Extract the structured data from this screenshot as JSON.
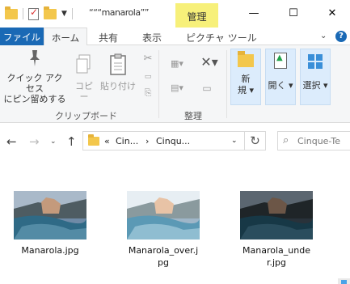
{
  "titlebar": {
    "title": "“““manarola””",
    "manage_tab": "管理",
    "minimize": "—",
    "maximize": "☐",
    "close": "✕"
  },
  "tabs": {
    "file": "ファイル",
    "home": "ホーム",
    "share": "共有",
    "view": "表示",
    "picture_tools": "ピクチャ ツール",
    "help": "?"
  },
  "ribbon": {
    "quick_access_line1": "クイック アクセス",
    "quick_access_line2": "にピン留めする",
    "copy": "コピー",
    "paste": "貼り付け",
    "clipboard_group": "クリップボード",
    "organize_group": "整理",
    "new_line1": "新",
    "new_line2": "規 ▾",
    "open": "開く ▾",
    "select": "選択 ▾"
  },
  "address": {
    "crumb_prefix": "«",
    "crumb1": "Cin...",
    "crumb2": "Cinqu...",
    "search_placeholder": "Cinque-Te"
  },
  "files": [
    {
      "name": "Manarola.jpg",
      "variant": "normal"
    },
    {
      "name": "Manarola_over.jpg",
      "variant": "over"
    },
    {
      "name": "Manarola_under.jpg",
      "variant": "under"
    }
  ]
}
